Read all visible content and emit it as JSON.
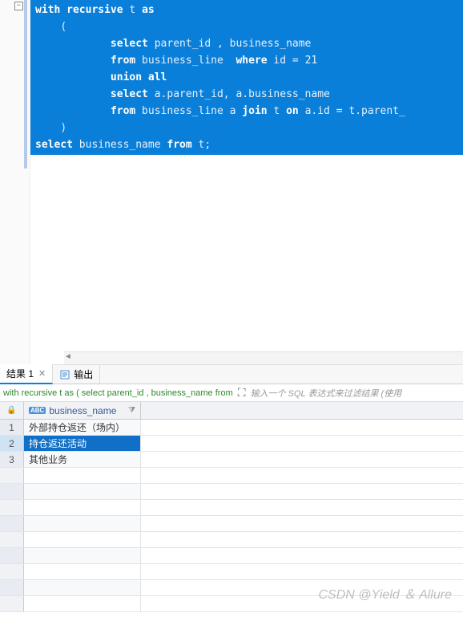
{
  "editor": {
    "code_lines": [
      {
        "indent": "",
        "tokens": [
          {
            "t": "with recursive",
            "k": true
          },
          {
            "t": " t ",
            "k": false
          },
          {
            "t": "as",
            "k": true
          }
        ]
      },
      {
        "indent": "    ",
        "tokens": [
          {
            "t": "(",
            "k": false
          }
        ]
      },
      {
        "indent": "            ",
        "tokens": [
          {
            "t": "select",
            "k": true
          },
          {
            "t": " parent_id , business_name",
            "k": false
          }
        ]
      },
      {
        "indent": "            ",
        "tokens": [
          {
            "t": "from",
            "k": true
          },
          {
            "t": " business_line  ",
            "k": false
          },
          {
            "t": "where",
            "k": true
          },
          {
            "t": " id = 21",
            "k": false
          }
        ]
      },
      {
        "indent": "            ",
        "tokens": [
          {
            "t": "union all",
            "k": true
          }
        ]
      },
      {
        "indent": "            ",
        "tokens": [
          {
            "t": "select",
            "k": true
          },
          {
            "t": " a.parent_id, a.business_name",
            "k": false
          }
        ]
      },
      {
        "indent": "            ",
        "tokens": [
          {
            "t": "from",
            "k": true
          },
          {
            "t": " business_line a ",
            "k": false
          },
          {
            "t": "join",
            "k": true
          },
          {
            "t": " t ",
            "k": false
          },
          {
            "t": "on",
            "k": true
          },
          {
            "t": " a.id = t.parent_",
            "k": false
          }
        ]
      },
      {
        "indent": "    ",
        "tokens": [
          {
            "t": ")",
            "k": false
          }
        ]
      },
      {
        "indent": "",
        "tokens": [
          {
            "t": "select",
            "k": true
          },
          {
            "t": " business_name ",
            "k": false
          },
          {
            "t": "from",
            "k": true
          },
          {
            "t": " t;",
            "k": false
          }
        ]
      }
    ],
    "fold_symbol": "−"
  },
  "tabs": {
    "results_label": "结果 1",
    "output_label": "输出"
  },
  "query_bar": {
    "query_preview": "with recursive t as ( select parent_id , business_name from",
    "filter_placeholder": "输入一个 SQL 表达式来过滤结果 (使用"
  },
  "grid": {
    "column": {
      "type_badge": "ABC",
      "name": "business_name"
    },
    "rows": [
      {
        "n": "1",
        "v": "外部持仓返还（场内）",
        "selected": false
      },
      {
        "n": "2",
        "v": "持仓返还活动",
        "selected": true
      },
      {
        "n": "3",
        "v": "其他业务",
        "selected": false
      }
    ],
    "empty_rows": 9
  },
  "watermark": "CSDN @Yield ＆ Allure"
}
